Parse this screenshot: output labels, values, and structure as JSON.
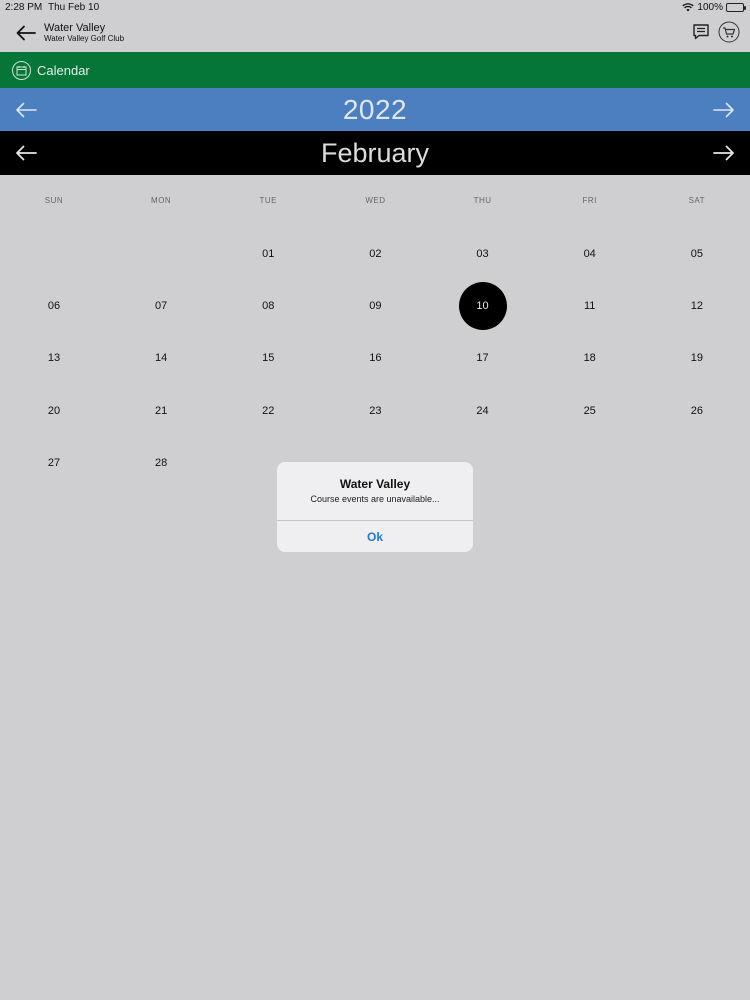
{
  "status": {
    "time": "2:28 PM",
    "date": "Thu Feb 10",
    "battery": "100%"
  },
  "nav": {
    "title": "Water Valley",
    "subtitle": "Water Valley Golf Club"
  },
  "section": {
    "title": "Calendar"
  },
  "year": {
    "label": "2022"
  },
  "month": {
    "label": "February"
  },
  "weekdays": [
    "SUN",
    "MON",
    "TUE",
    "WED",
    "THU",
    "FRI",
    "SAT"
  ],
  "days": [
    "01",
    "02",
    "03",
    "04",
    "05",
    "06",
    "07",
    "08",
    "09",
    "10",
    "11",
    "12",
    "13",
    "14",
    "15",
    "16",
    "17",
    "18",
    "19",
    "20",
    "21",
    "22",
    "23",
    "24",
    "25",
    "26",
    "27",
    "28"
  ],
  "first_weekday_index": 2,
  "selected_day": "10",
  "alert": {
    "title": "Water Valley",
    "message": "Course events are unavailable...",
    "ok_label": "Ok"
  },
  "colors": {
    "section_bar": "#067638",
    "year_bar": "#4c7fbf",
    "month_bar": "#000000",
    "alert_button": "#1f7ad4"
  }
}
